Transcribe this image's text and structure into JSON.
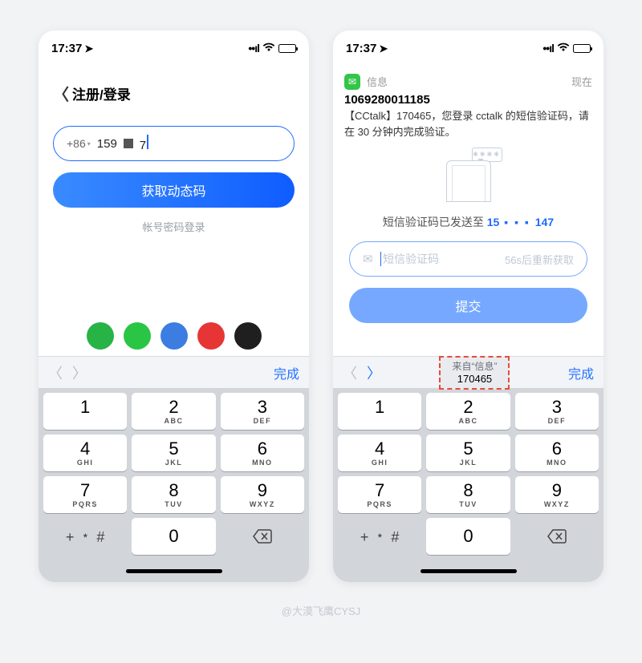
{
  "watermark": "@大漠飞鹰CYSJ",
  "status": {
    "time": "17:37",
    "signal": "::!!",
    "wifi": "􀙇"
  },
  "left": {
    "title": "注册/登录",
    "country_code": "+86",
    "phone_prefix": "159",
    "phone_tail": "7",
    "get_code_btn": "获取动态码",
    "password_login": "帐号密码登录",
    "social_colors": [
      "#28b346",
      "#2ac545",
      "#3b7de0",
      "#e73535",
      "#1f1f1f"
    ]
  },
  "right": {
    "notif_app": "信息",
    "notif_time": "现在",
    "sender": "1069280011185",
    "sms_text": "【CCtalk】170465，您登录 cctalk 的短信验证码，请在 30 分钟内完成验证。",
    "sent_line_prefix": "短信验证码已发送至",
    "sent_phone_head": "15",
    "sent_phone_tail": "147",
    "code_placeholder": "短信验证码",
    "resend_text": "56s后重新获取",
    "submit_btn": "提交",
    "autofill_from": "来自“信息”",
    "autofill_code": "170465"
  },
  "keyboard": {
    "done": "完成",
    "symbols": "+ ﹡ #",
    "keys": [
      {
        "d": "1",
        "l": ""
      },
      {
        "d": "2",
        "l": "ABC"
      },
      {
        "d": "3",
        "l": "DEF"
      },
      {
        "d": "4",
        "l": "GHI"
      },
      {
        "d": "5",
        "l": "JKL"
      },
      {
        "d": "6",
        "l": "MNO"
      },
      {
        "d": "7",
        "l": "PQRS"
      },
      {
        "d": "8",
        "l": "TUV"
      },
      {
        "d": "9",
        "l": "WXYZ"
      },
      {
        "d": "0",
        "l": ""
      }
    ]
  }
}
